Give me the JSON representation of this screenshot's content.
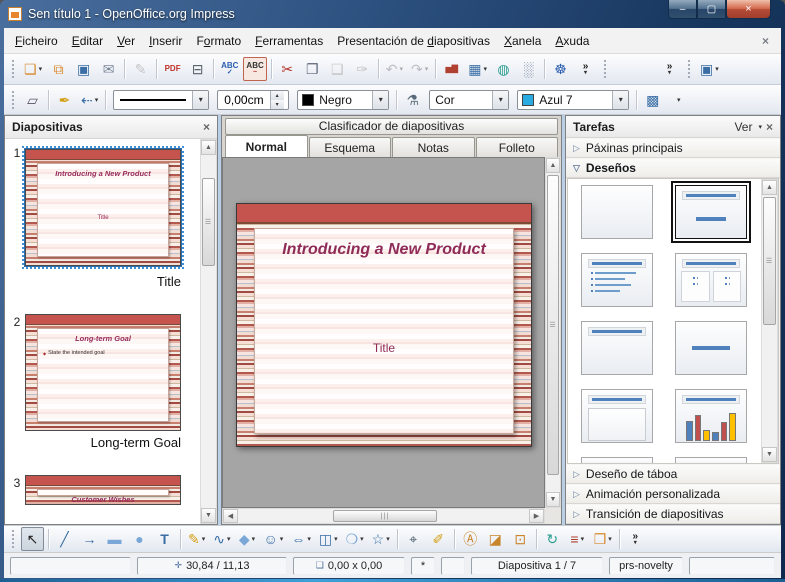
{
  "window": {
    "title": "Sen título 1 - OpenOffice.org Impress",
    "controls": [
      {
        "id": "minimize-button",
        "icon": "minimize-icon",
        "glyph": "–"
      },
      {
        "id": "maximize-button",
        "icon": "maximize-icon",
        "glyph": "▢"
      },
      {
        "id": "close-button",
        "icon": "close-icon",
        "glyph": "×",
        "kind": "close"
      }
    ]
  },
  "menubar": {
    "items": [
      {
        "id": "menu-ficheiro",
        "pre": "",
        "u": "F",
        "post": "icheiro"
      },
      {
        "id": "menu-editar",
        "pre": "",
        "u": "E",
        "post": "ditar"
      },
      {
        "id": "menu-ver",
        "pre": "",
        "u": "V",
        "post": "er"
      },
      {
        "id": "menu-inserir",
        "pre": "",
        "u": "I",
        "post": "nserir"
      },
      {
        "id": "menu-formato",
        "pre": "F",
        "u": "o",
        "post": "rmato"
      },
      {
        "id": "menu-ferramentas",
        "pre": "",
        "u": "F",
        "post": "erramentas"
      },
      {
        "id": "menu-presentacion-de-diapositivas",
        "pre": "Presentación de ",
        "u": "d",
        "post": "iapositivas"
      },
      {
        "id": "menu-xanela",
        "pre": "",
        "u": "X",
        "post": "anela"
      },
      {
        "id": "menu-axuda",
        "pre": "",
        "u": "A",
        "post": "xuda"
      }
    ],
    "close_glyph": "×"
  },
  "toolbar_standard": {
    "buttons": [
      {
        "name": "new-button",
        "icon": "new-document-icon",
        "glyph": "❏",
        "color": "#d9882b",
        "dd": true
      },
      {
        "name": "open-button",
        "icon": "open-folder-icon",
        "glyph": "⧉",
        "color": "#d9882b"
      },
      {
        "name": "save-button",
        "icon": "save-icon",
        "glyph": "▣",
        "color": "#3a6ea5"
      },
      {
        "name": "email-button",
        "icon": "email-icon",
        "glyph": "✉",
        "color": "#7a8699"
      },
      {
        "sep": true
      },
      {
        "name": "edit-file-button",
        "icon": "edit-file-icon",
        "glyph": "✎",
        "color": "#6a7a8a",
        "disabled": true
      },
      {
        "sep": true
      },
      {
        "name": "export-pdf-button",
        "icon": "pdf-icon",
        "glyph": "PDF",
        "color": "#c03028",
        "text": true
      },
      {
        "name": "print-button",
        "icon": "print-icon",
        "glyph": "⊟",
        "color": "#5a646e"
      },
      {
        "sep": true
      },
      {
        "name": "spelling-button",
        "icon": "spellcheck-icon",
        "glyph": "ABC",
        "color": "#2a5db0",
        "text": true,
        "sub": "✓",
        "subcolor": "#2a5db0"
      },
      {
        "name": "auto-spellcheck-button",
        "icon": "autospellcheck-icon",
        "glyph": "ABC",
        "color": "#333333",
        "text": true,
        "sub": "~",
        "subcolor": "#c03028",
        "active": true
      },
      {
        "sep": true
      },
      {
        "name": "cut-button",
        "icon": "cut-icon",
        "glyph": "✂",
        "color": "#b3342a"
      },
      {
        "name": "copy-button",
        "icon": "copy-icon",
        "glyph": "❐",
        "color": "#5a6678"
      },
      {
        "name": "paste-button",
        "icon": "paste-icon",
        "glyph": "❑",
        "color": "#8a7a5a",
        "disabled": true
      },
      {
        "name": "format-paintbrush-button",
        "icon": "paintbrush-icon",
        "glyph": "✑",
        "color": "#8a7a5a",
        "disabled": true
      },
      {
        "sep": true
      },
      {
        "name": "undo-button",
        "icon": "undo-icon",
        "glyph": "↶",
        "color": "#3a6ea5",
        "disabled": true,
        "dd": true
      },
      {
        "name": "redo-button",
        "icon": "redo-icon",
        "glyph": "↷",
        "color": "#3a6ea5",
        "disabled": true,
        "dd": true
      },
      {
        "sep": true
      },
      {
        "name": "insert-chart-button",
        "icon": "chart-icon",
        "glyph": "▅▇",
        "color": "#b04030",
        "text": true
      },
      {
        "name": "insert-table-button",
        "icon": "table-icon",
        "glyph": "▦",
        "color": "#3a6ea5",
        "dd": true
      },
      {
        "name": "hyperlink-button",
        "icon": "hyperlink-icon",
        "glyph": "◍",
        "color": "#2a9d8f"
      },
      {
        "name": "grid-button",
        "icon": "grid-icon",
        "glyph": "░",
        "color": "#5a6a8a"
      },
      {
        "sep": true
      },
      {
        "name": "navigator-button",
        "icon": "navigator-icon",
        "glyph": "☸",
        "color": "#2a5db0"
      },
      {
        "name": "standard-overflow-button",
        "icon": "overflow-icon",
        "glyph": "»",
        "stack": true
      }
    ],
    "group2": [
      {
        "name": "presentation-overflow-button",
        "icon": "overflow-icon",
        "glyph": "»",
        "stack": true
      }
    ],
    "group3": [
      {
        "name": "presentation-view-button",
        "icon": "presentation-icon",
        "glyph": "▣",
        "color": "#3a6ea5",
        "dd": true
      }
    ]
  },
  "line_bar": {
    "points_glyph": "▱",
    "pen_glyph": "✒",
    "arrow_glyph": "⇠",
    "width_value": "0,00cm",
    "spin_up": "▴",
    "spin_down": "▾",
    "line_color_label": "Negro",
    "line_color_swatch": "#000000",
    "bucket_glyph": "⚗",
    "fill_type_label": "Cor",
    "fill_color_label": "Azul 7",
    "fill_color_swatch": "#29aae1",
    "shadow_glyph": "▩",
    "dropdown_glyph": "▾"
  },
  "slides_panel": {
    "title": "Diapositivas",
    "close_glyph": "×",
    "slides": [
      {
        "number": "1",
        "slide_title": "Introducing a New Product",
        "body_text": "Title",
        "label": "Title",
        "selected": true
      },
      {
        "number": "2",
        "slide_title": "Long-term Goal",
        "bullet_text": "State the intended goal",
        "label": "Long-term Goal",
        "selected": false
      },
      {
        "number": "3",
        "slide_title": "Customer Wishes",
        "label": "",
        "selected": false,
        "cut": true
      }
    ]
  },
  "view_bar": {
    "classifier_label": "Clasificador de diapositivas",
    "tabs": [
      {
        "id": "tab-normal",
        "label": "Normal",
        "active": true
      },
      {
        "id": "tab-esquema",
        "label": "Esquema",
        "active": false
      },
      {
        "id": "tab-notas",
        "label": "Notas",
        "active": false
      },
      {
        "id": "tab-folleto",
        "label": "Folleto",
        "active": false
      }
    ]
  },
  "canvas": {
    "slide_title": "Introducing a New Product",
    "placeholder_text": "Title"
  },
  "tasks_panel": {
    "title": "Tarefas",
    "view_label": "Ver",
    "view_dd": "▾",
    "close_glyph": "×",
    "sections": [
      {
        "label": "Páxinas principais",
        "tri": "▷"
      },
      {
        "label": "Deseños",
        "tri": "▽"
      },
      {
        "label": "Deseño de táboa",
        "tri": "▷"
      },
      {
        "label": "Animación personalizada",
        "tri": "▷"
      },
      {
        "label": "Transición de diapositivas",
        "tri": "▷"
      }
    ],
    "layouts": [
      {
        "name": "layout-blank",
        "kind": "blank",
        "selected": false
      },
      {
        "name": "layout-title-content",
        "kind": "title-content",
        "selected": true
      },
      {
        "name": "layout-title-outline",
        "kind": "title-bullets",
        "selected": false
      },
      {
        "name": "layout-two-content",
        "kind": "title-two",
        "selected": false
      },
      {
        "name": "layout-title-only",
        "kind": "title-only",
        "selected": false
      },
      {
        "name": "layout-centered-text",
        "kind": "center-line",
        "selected": false
      },
      {
        "name": "layout-title-content-box",
        "kind": "title-box",
        "selected": false
      },
      {
        "name": "layout-title-chart",
        "kind": "title-chart",
        "selected": false
      },
      {
        "name": "layout-cutoff-1",
        "kind": "cutoff",
        "selected": false
      },
      {
        "name": "layout-cutoff-2",
        "kind": "cutoff",
        "selected": false
      }
    ]
  },
  "toolbar_drawing": {
    "buttons": [
      {
        "name": "select-tool-button",
        "icon": "cursor-icon",
        "glyph": "↖",
        "color": "#222222",
        "active": true
      },
      {
        "sep": true
      },
      {
        "name": "line-tool-button",
        "icon": "line-icon",
        "glyph": "╱",
        "color": "#3a6ea5"
      },
      {
        "name": "arrow-tool-button",
        "icon": "arrow-icon",
        "glyph": "→",
        "color": "#3a6ea5"
      },
      {
        "name": "rectangle-tool-button",
        "icon": "rectangle-icon",
        "glyph": "▬",
        "color": "#7aa7d6"
      },
      {
        "name": "ellipse-tool-button",
        "icon": "ellipse-icon",
        "glyph": "●",
        "color": "#7aa7d6"
      },
      {
        "name": "text-tool-button",
        "icon": "text-icon",
        "glyph": "T",
        "color": "#3a6ea5",
        "big": true
      },
      {
        "sep": true
      },
      {
        "name": "curve-tool-button",
        "icon": "curve-icon",
        "glyph": "✎",
        "color": "#d4a017",
        "dd": true
      },
      {
        "name": "connector-tool-button",
        "icon": "connector-icon",
        "glyph": "∿",
        "color": "#3a6ea5",
        "dd": true
      },
      {
        "name": "basic-shapes-button",
        "icon": "diamond-icon",
        "glyph": "◆",
        "color": "#7aa7d6",
        "dd": true
      },
      {
        "name": "symbol-shapes-button",
        "icon": "smiley-icon",
        "glyph": "☺",
        "color": "#3a6ea5",
        "dd": true
      },
      {
        "name": "block-arrows-button",
        "icon": "block-arrow-icon",
        "glyph": "⇔",
        "color": "#3a6ea5",
        "dd": true
      },
      {
        "name": "flowchart-button",
        "icon": "flowchart-icon",
        "glyph": "◫",
        "color": "#3a6ea5",
        "dd": true
      },
      {
        "name": "callouts-button",
        "icon": "callout-icon",
        "glyph": "❍",
        "color": "#7aa7d6",
        "dd": true
      },
      {
        "name": "stars-button",
        "icon": "star-icon",
        "glyph": "☆",
        "color": "#3a6ea5",
        "dd": true
      },
      {
        "sep": true
      },
      {
        "name": "edit-points-button",
        "icon": "edit-points-icon",
        "glyph": "⌖",
        "color": "#445566"
      },
      {
        "name": "glue-points-button",
        "icon": "glue-points-icon",
        "glyph": "✐",
        "color": "#d4a017"
      },
      {
        "sep": true
      },
      {
        "name": "fontwork-button",
        "icon": "fontwork-icon",
        "glyph": "Ⓐ",
        "color": "#c8862b"
      },
      {
        "name": "picture-from-file-button",
        "icon": "picture-icon",
        "glyph": "◪",
        "color": "#c8862b"
      },
      {
        "name": "gallery-button",
        "icon": "gallery-icon",
        "glyph": "⊡",
        "color": "#c8862b"
      },
      {
        "sep": true
      },
      {
        "name": "rotate-button",
        "icon": "rotate-icon",
        "glyph": "↻",
        "color": "#2a9d8f"
      },
      {
        "name": "alignment-button",
        "icon": "align-icon",
        "glyph": "≡",
        "color": "#b04030",
        "dd": true
      },
      {
        "name": "arrange-button",
        "icon": "arrange-icon",
        "glyph": "❒",
        "color": "#d9882b",
        "dd": true
      },
      {
        "sep": true
      },
      {
        "name": "drawing-overflow-button",
        "icon": "overflow-icon",
        "glyph": "»",
        "stack": true
      }
    ]
  },
  "status_bar": {
    "fields": [
      {
        "name": "status-info",
        "text": "",
        "w": 0,
        "grow": true
      },
      {
        "name": "status-position",
        "icon": "✛",
        "text": "30,84 / 11,13",
        "w": 150
      },
      {
        "name": "status-size",
        "icon": "❑",
        "text": "0,00 x 0,00",
        "w": 112
      },
      {
        "name": "status-modified",
        "text": "*",
        "w": 24
      },
      {
        "name": "status-signature",
        "text": "",
        "w": 24
      },
      {
        "name": "status-slide",
        "text": "Diapositiva 1 / 7",
        "w": 132
      },
      {
        "name": "status-template",
        "text": "prs-novelty",
        "w": 74
      },
      {
        "name": "status-zoom",
        "text": "",
        "w": 86
      }
    ]
  },
  "colors": {
    "accent_fill": "#29aae1",
    "slide_title_text": "#8e2b57",
    "template_red": "#c5534e",
    "layout_blue": "#4f81bd"
  }
}
